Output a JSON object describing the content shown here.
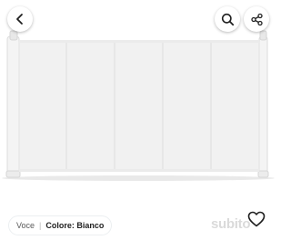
{
  "toolbar": {
    "back_icon": "chevron-left-icon",
    "search_icon": "search-icon",
    "share_icon": "share-icon"
  },
  "attribute_chip": {
    "key": "Voce",
    "separator": "|",
    "label": "Colore:",
    "value": "Bianco"
  },
  "watermark": {
    "text": "subito"
  },
  "favorite": {
    "icon": "heart-icon"
  },
  "colors": {
    "background": "#ffffff",
    "product": "#f2f2f2",
    "icon": "#1f1f1f"
  }
}
